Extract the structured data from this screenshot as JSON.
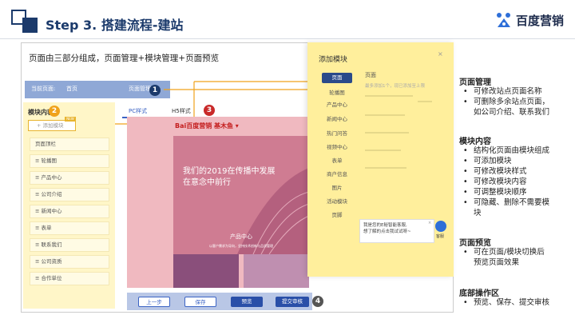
{
  "slide": {
    "title": "Step 3. 搭建流程-建站",
    "brand": "百度营销",
    "screenshot_caption": "页面由三部分组成，页面管理+模块管理+页面预览"
  },
  "builder": {
    "topbar": {
      "current_page_label": "当前页面:",
      "current_page_value": "首页",
      "manage_label": "页面管理"
    },
    "badges": {
      "b1": "1",
      "b2": "2",
      "b3": "3",
      "b4": "4"
    },
    "left_panel": {
      "title": "模块内容",
      "add_button": "+ 添加模块",
      "add_tag": "NEW",
      "items": [
        "页面顶栏",
        "≡  轮播图",
        "≡  产品中心",
        "≡  公司介绍",
        "≡  新闻中心",
        "≡  表单",
        "≡  联系我们",
        "≡  公司资质",
        "≡  合作单位"
      ]
    },
    "tabs": {
      "pc": "PC样式",
      "h5": "H5样式"
    },
    "preview": {
      "logo": "Bai百度营销  基木鱼 ▾",
      "hero_line1": "我们的2019在传播中发展",
      "hero_line2": "在意念中前行",
      "product_title": "产品中心",
      "product_sub": "以客户需求为导向，坚持技术创新与品质管理"
    },
    "bottom_bar": {
      "prev": "上一步",
      "save": "保存",
      "preview": "预览",
      "submit": "提交审核"
    }
  },
  "modal": {
    "title": "添加模块",
    "close": "×",
    "items": [
      "页面",
      "轮播图",
      "产品中心",
      "新闻中心",
      "热门问答",
      "视频中心",
      "表单",
      "商户信息",
      "图片",
      "活动模块",
      "页脚"
    ],
    "section_label": "页面",
    "section_sub": "最多添加1个，现已添加至上限",
    "chat_text_1": "我是您的E秘智能客服,",
    "chat_text_2": "想了解的点击我试试呀~",
    "chat_close": "×",
    "service_label": "客服"
  },
  "notes": [
    {
      "heading": "页面管理",
      "items": [
        "可修改站点页面名称",
        "可删除多余站点页面，",
        "如公司介绍、联系我们"
      ],
      "continuation_index": 2
    },
    {
      "heading": "模块内容",
      "items": [
        "结构化页面由模块组成",
        "可添加模块",
        "可修改模块样式",
        "可修改模块内容",
        "可调整模块顺序",
        "可隐藏、删除不需要模",
        "块"
      ],
      "continuation_index": 6
    },
    {
      "heading": "页面预览",
      "items": [
        "可在页面/模块切换后",
        "预览页面效果"
      ],
      "continuation_index": 1
    },
    {
      "heading": "底部操作区",
      "items": [
        "预览、保存、提交审核"
      ],
      "continuation_index": -1
    }
  ],
  "colors": {
    "navy": "#1b3a6b",
    "blue": "#3b63c4",
    "red": "#c92a2a",
    "orange": "#f0a21b",
    "yellow": "#ffef9c"
  }
}
